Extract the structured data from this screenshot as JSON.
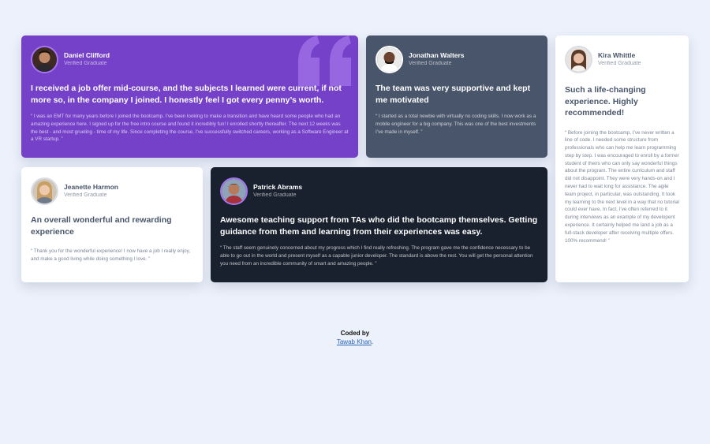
{
  "colors": {
    "page_bg": "#ecf1fb",
    "purple": "#7541c8",
    "slate": "#48556a",
    "dark": "#19212e",
    "white": "#ffffff"
  },
  "testimonials": [
    {
      "name": "Daniel Clifford",
      "role": "Verified Graduate",
      "headline": "I received a job offer mid-course, and the subjects I learned were current, if not more so, in the company I joined. I honestly feel I got every penny’s worth.",
      "body": "“ I was an EMT for many years before I joined the bootcamp. I’ve been looking to make a transition and have heard some people who had an amazing experience here. I signed up for the free intro course and found it incredibly fun! I enrolled shortly thereafter. The next 12 weeks was the best - and most grueling - time of my life. Since completing the course, I’ve successfully switched careers, working as a Software Engineer at a VR startup. ”",
      "icon": "quotation-mark-icon"
    },
    {
      "name": "Jonathan Walters",
      "role": "Verified Graduate",
      "headline": "The team was very supportive and kept me motivated",
      "body": "“ I started as a total newbie with virtually no coding skills. I now work as a mobile engineer for a big company. This was one of the best investments I’ve made in myself. ”"
    },
    {
      "name": "Kira Whittle",
      "role": "Verified Graduate",
      "headline": "Such a life-changing experience. Highly recommended!",
      "body": "“ Before joining the bootcamp, I’ve never written a line of code. I needed some structure from professionals who can help me learn programming step by step. I was encouraged to enroll by a former student of theirs who can only say wonderful things about the program. The entire curriculum and staff did not disappoint. They were very hands-on and I never had to wait long for assistance. The agile team project, in particular, was outstanding. It took my learning to the next level in a way that no tutorial could ever have. In fact, I’ve often referred to it during interviews as an example of my developent experience. It certainly helped me land a job as a full-stack developer after receiving multiple offers. 100% recommend! ”"
    },
    {
      "name": "Jeanette Harmon",
      "role": "Verified Graduate",
      "headline": "An overall wonderful and rewarding experience",
      "body": "“ Thank you for the wonderful experience! I now have a job I really enjoy, and make a good living while doing something I love. ”"
    },
    {
      "name": "Patrick Abrams",
      "role": "Verified Graduate",
      "headline": "Awesome teaching support from TAs who did the bootcamp themselves. Getting guidance from them and learning from their experiences was easy.",
      "body": "“ The staff seem genuinely concerned about my progress which I find really refreshing. The program gave me the confidence necessary to be able to go out in the world and present myself as a capable junior developer. The standard is above the rest. You will get the personal attention you need from an incredible community of smart and amazing people. ”"
    }
  ],
  "footer": {
    "coded_by": "Coded by",
    "author_link": "Tawab Khan",
    "suffix": "."
  }
}
